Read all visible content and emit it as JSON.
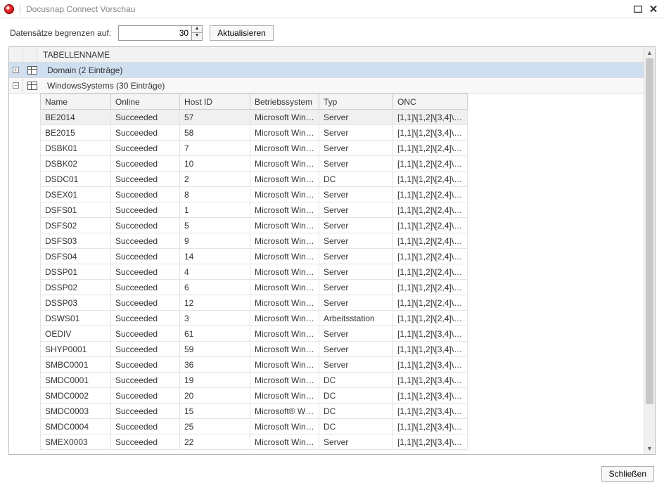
{
  "window": {
    "title": "Docusnap Connect Vorschau"
  },
  "toolbar": {
    "limit_label": "Datensätze begrenzen auf:",
    "limit_value": "30",
    "refresh_label": "Aktualisieren"
  },
  "grid": {
    "header_label": "TABELLENNAME",
    "groups": [
      {
        "label": "Domain (2 Einträge)",
        "expanded": false,
        "selected": true
      },
      {
        "label": "WindowsSystems (30 Einträge)",
        "expanded": true,
        "selected": false
      }
    ],
    "columns": [
      "Name",
      "Online",
      "Host ID",
      "Betriebssystem",
      "Typ",
      "ONC"
    ],
    "rows": [
      {
        "name": "BE2014",
        "online": "Succeeded",
        "host": "57",
        "os": "Microsoft Wind...",
        "typ": "Server",
        "onc": "[1,1]\\[1,2]\\[3,4]\\[..."
      },
      {
        "name": "BE2015",
        "online": "Succeeded",
        "host": "58",
        "os": "Microsoft Wind...",
        "typ": "Server",
        "onc": "[1,1]\\[1,2]\\[3,4]\\[..."
      },
      {
        "name": "DSBK01",
        "online": "Succeeded",
        "host": "7",
        "os": "Microsoft Wind...",
        "typ": "Server",
        "onc": "[1,1]\\[1,2]\\[2,4]\\[..."
      },
      {
        "name": "DSBK02",
        "online": "Succeeded",
        "host": "10",
        "os": "Microsoft Wind...",
        "typ": "Server",
        "onc": "[1,1]\\[1,2]\\[2,4]\\[..."
      },
      {
        "name": "DSDC01",
        "online": "Succeeded",
        "host": "2",
        "os": "Microsoft Wind...",
        "typ": "DC",
        "onc": "[1,1]\\[1,2]\\[2,4]\\[..."
      },
      {
        "name": "DSEX01",
        "online": "Succeeded",
        "host": "8",
        "os": "Microsoft Wind...",
        "typ": "Server",
        "onc": "[1,1]\\[1,2]\\[2,4]\\[..."
      },
      {
        "name": "DSFS01",
        "online": "Succeeded",
        "host": "1",
        "os": "Microsoft Wind...",
        "typ": "Server",
        "onc": "[1,1]\\[1,2]\\[2,4]\\[..."
      },
      {
        "name": "DSFS02",
        "online": "Succeeded",
        "host": "5",
        "os": "Microsoft Wind...",
        "typ": "Server",
        "onc": "[1,1]\\[1,2]\\[2,4]\\[..."
      },
      {
        "name": "DSFS03",
        "online": "Succeeded",
        "host": "9",
        "os": "Microsoft Wind...",
        "typ": "Server",
        "onc": "[1,1]\\[1,2]\\[2,4]\\[..."
      },
      {
        "name": "DSFS04",
        "online": "Succeeded",
        "host": "14",
        "os": "Microsoft Wind...",
        "typ": "Server",
        "onc": "[1,1]\\[1,2]\\[2,4]\\[..."
      },
      {
        "name": "DSSP01",
        "online": "Succeeded",
        "host": "4",
        "os": "Microsoft Wind...",
        "typ": "Server",
        "onc": "[1,1]\\[1,2]\\[2,4]\\[..."
      },
      {
        "name": "DSSP02",
        "online": "Succeeded",
        "host": "6",
        "os": "Microsoft Wind...",
        "typ": "Server",
        "onc": "[1,1]\\[1,2]\\[2,4]\\[..."
      },
      {
        "name": "DSSP03",
        "online": "Succeeded",
        "host": "12",
        "os": "Microsoft Wind...",
        "typ": "Server",
        "onc": "[1,1]\\[1,2]\\[2,4]\\[..."
      },
      {
        "name": "DSWS01",
        "online": "Succeeded",
        "host": "3",
        "os": "Microsoft Wind...",
        "typ": "Arbeitsstation",
        "onc": "[1,1]\\[1,2]\\[2,4]\\[..."
      },
      {
        "name": "OEDIV",
        "online": "Succeeded",
        "host": "61",
        "os": "Microsoft Wind...",
        "typ": "Server",
        "onc": "[1,1]\\[1,2]\\[3,4]\\[..."
      },
      {
        "name": "SHYP0001",
        "online": "Succeeded",
        "host": "59",
        "os": "Microsoft Wind...",
        "typ": "Server",
        "onc": "[1,1]\\[1,2]\\[3,4]\\[..."
      },
      {
        "name": "SMBC0001",
        "online": "Succeeded",
        "host": "36",
        "os": "Microsoft Wind...",
        "typ": "Server",
        "onc": "[1,1]\\[1,2]\\[3,4]\\[..."
      },
      {
        "name": "SMDC0001",
        "online": "Succeeded",
        "host": "19",
        "os": "Microsoft Wind...",
        "typ": "DC",
        "onc": "[1,1]\\[1,2]\\[3,4]\\[..."
      },
      {
        "name": "SMDC0002",
        "online": "Succeeded",
        "host": "20",
        "os": "Microsoft Wind...",
        "typ": "DC",
        "onc": "[1,1]\\[1,2]\\[3,4]\\[..."
      },
      {
        "name": "SMDC0003",
        "online": "Succeeded",
        "host": "15",
        "os": "Microsoft® Win...",
        "typ": "DC",
        "onc": "[1,1]\\[1,2]\\[3,4]\\[..."
      },
      {
        "name": "SMDC0004",
        "online": "Succeeded",
        "host": "25",
        "os": "Microsoft Wind...",
        "typ": "DC",
        "onc": "[1,1]\\[1,2]\\[3,4]\\[..."
      },
      {
        "name": "SMEX0003",
        "online": "Succeeded",
        "host": "22",
        "os": "Microsoft Wind...",
        "typ": "Server",
        "onc": "[1,1]\\[1,2]\\[3,4]\\[..."
      }
    ]
  },
  "footer": {
    "close_label": "Schließen"
  }
}
